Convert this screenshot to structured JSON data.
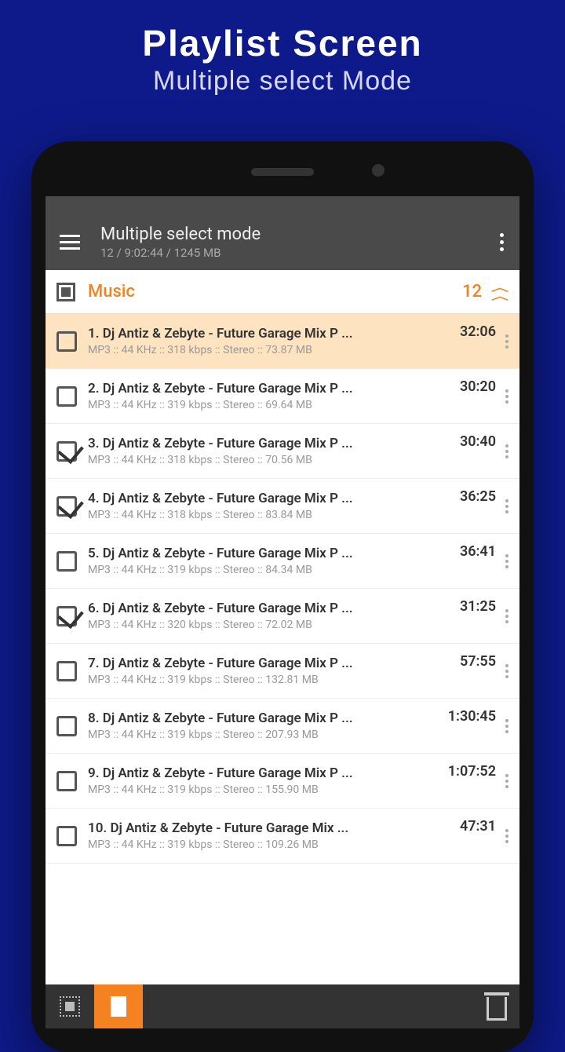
{
  "promo": {
    "title": "Playlist Screen",
    "subtitle": "Multiple select Mode"
  },
  "appbar": {
    "title": "Multiple select mode",
    "subtitle": "12 / 9:02:44 / 1245 MB"
  },
  "section": {
    "title": "Music",
    "count": "12"
  },
  "tracks": [
    {
      "title": "1. Dj Antiz & Zebyte - Future Garage Mix P ...",
      "sub": "MP3 :: 44 KHz :: 318 kbps :: Stereo :: 73.87 MB",
      "dur": "32:06",
      "checked": false,
      "playing": true
    },
    {
      "title": "2. Dj Antiz & Zebyte - Future Garage Mix P ...",
      "sub": "MP3 :: 44 KHz :: 319 kbps :: Stereo :: 69.64 MB",
      "dur": "30:20",
      "checked": false,
      "playing": false
    },
    {
      "title": "3. Dj Antiz & Zebyte - Future Garage Mix P ...",
      "sub": "MP3 :: 44 KHz :: 318 kbps :: Stereo :: 70.56 MB",
      "dur": "30:40",
      "checked": true,
      "playing": false
    },
    {
      "title": "4. Dj Antiz & Zebyte - Future Garage Mix P ...",
      "sub": "MP3 :: 44 KHz :: 318 kbps :: Stereo :: 83.84 MB",
      "dur": "36:25",
      "checked": true,
      "playing": false
    },
    {
      "title": "5. Dj Antiz & Zebyte - Future Garage Mix P ...",
      "sub": "MP3 :: 44 KHz :: 319 kbps :: Stereo :: 84.34 MB",
      "dur": "36:41",
      "checked": false,
      "playing": false
    },
    {
      "title": "6. Dj Antiz & Zebyte - Future Garage Mix P ...",
      "sub": "MP3 :: 44 KHz :: 320 kbps :: Stereo :: 72.02 MB",
      "dur": "31:25",
      "checked": true,
      "playing": false
    },
    {
      "title": "7. Dj Antiz & Zebyte - Future Garage Mix P ...",
      "sub": "MP3 :: 44 KHz :: 319 kbps :: Stereo :: 132.81 MB",
      "dur": "57:55",
      "checked": false,
      "playing": false
    },
    {
      "title": "8. Dj Antiz & Zebyte - Future Garage Mix P ...",
      "sub": "MP3 :: 44 KHz :: 319 kbps :: Stereo :: 207.93 MB",
      "dur": "1:30:45",
      "checked": false,
      "playing": false
    },
    {
      "title": "9. Dj Antiz & Zebyte - Future Garage Mix P ...",
      "sub": "MP3 :: 44 KHz :: 319 kbps :: Stereo :: 155.90 MB",
      "dur": "1:07:52",
      "checked": false,
      "playing": false
    },
    {
      "title": "10. Dj Antiz & Zebyte - Future Garage Mix  ...",
      "sub": "MP3 :: 44 KHz :: 319 kbps :: Stereo :: 109.26 MB",
      "dur": "47:31",
      "checked": false,
      "playing": false
    }
  ]
}
